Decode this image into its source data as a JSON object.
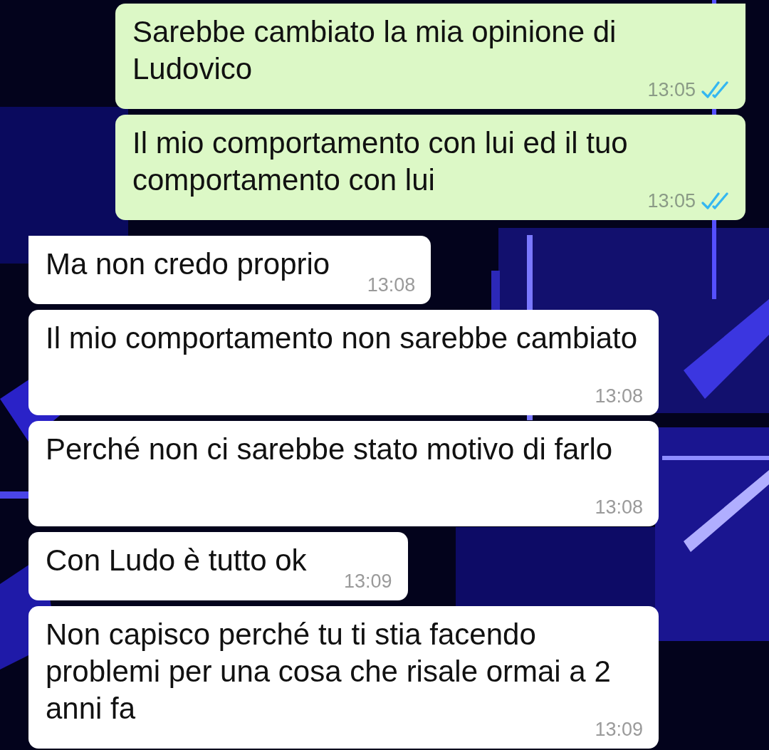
{
  "messages": [
    {
      "kind": "outgoing",
      "text": "Sarebbe cambiato la mia opinione di Ludovico",
      "time": "13:05",
      "read": true,
      "first": true
    },
    {
      "kind": "outgoing",
      "text": "Il mio comportamento con lui ed il tuo comportamento con lui",
      "time": "13:05",
      "read": true,
      "first": false
    },
    {
      "kind": "incoming",
      "text": "Ma non credo proprio",
      "time": "13:08",
      "first": true
    },
    {
      "kind": "incoming",
      "text": "Il mio comportamento non sarebbe cambiato",
      "time": "13:08",
      "first": false
    },
    {
      "kind": "incoming",
      "text": "Perché non ci sarebbe stato motivo di farlo",
      "time": "13:08",
      "first": false
    },
    {
      "kind": "incoming",
      "text": "Con Ludo è tutto ok",
      "time": "13:09",
      "first": false
    },
    {
      "kind": "incoming",
      "text": "Non capisco perché tu ti stia facendo problemi per una cosa che risale ormai a 2 anni fa",
      "time": "13:09",
      "first": false
    }
  ]
}
